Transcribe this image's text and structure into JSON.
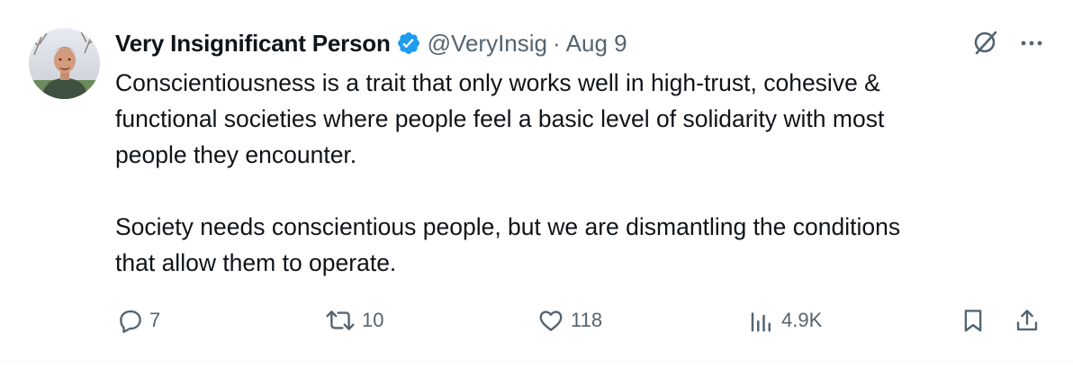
{
  "author": {
    "display_name": "Very Insignificant Person",
    "handle": "@VeryInsig",
    "separator": "·",
    "date": "Aug 9",
    "verified": true
  },
  "icons": {
    "verified": "verified-badge-icon",
    "grok": "grok-slash-icon",
    "more": "more-horizontal-icon",
    "reply": "reply-bubble-icon",
    "retweet": "retweet-icon",
    "like": "heart-icon",
    "views": "analytics-bars-icon",
    "bookmark": "bookmark-icon",
    "share": "share-icon"
  },
  "tweet": {
    "paragraph1_lines": [
      "Conscientiousness is a trait that only works well in high-trust, cohesive &",
      "functional societies where people feel a basic level of solidarity with most",
      "people they encounter."
    ],
    "paragraph2_lines": [
      "Society needs conscientious people, but we are dismantling the conditions",
      "that allow them to operate."
    ]
  },
  "actions": {
    "replies": "7",
    "retweets": "10",
    "likes": "118",
    "views": "4.9K"
  },
  "colors": {
    "text_primary": "#0f1419",
    "text_secondary": "#536471",
    "verified_blue": "#1d9bf0",
    "divider": "#eff3f4"
  }
}
